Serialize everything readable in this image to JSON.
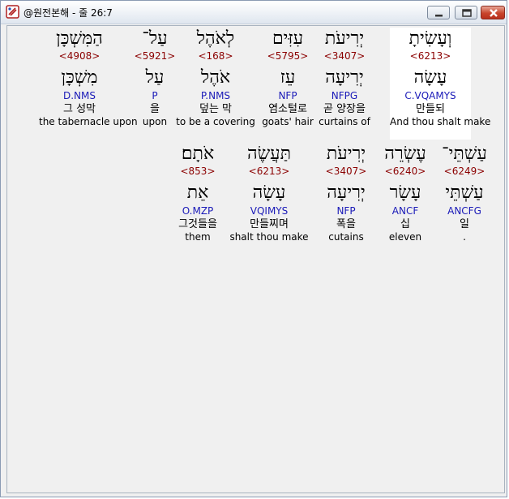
{
  "window": {
    "title": "@원전본해 - 줄 26:7"
  },
  "lines": [
    [
      {
        "heb": "וְעָשִׂיתָ",
        "strong": "<6213>",
        "lemma": "עָשָׂה",
        "morph": "C.VQAMYS",
        "ko": "만들되",
        "en": "And thou shalt make"
      },
      {
        "heb": "יְרִיעֹת",
        "strong": "<3407>",
        "lemma": "יְרִיעָה",
        "morph": "NFPG",
        "ko": "곧 양장을",
        "en": "curtains of"
      },
      {
        "heb": "עִזִּים",
        "strong": "<5795>",
        "lemma": "עֵז",
        "morph": "NFP",
        "ko": "염소털로",
        "en": "goats' hair"
      },
      {
        "heb": "לְאֹהֶל",
        "strong": "<168>",
        "lemma": "אֹהֶל",
        "morph": "P.NMS",
        "ko": "덮는 막",
        "en": "to be a covering"
      },
      {
        "heb": "עַל־",
        "strong": "<5921>",
        "lemma": "עַל",
        "morph": "P",
        "ko": "을",
        "en": "upon"
      },
      {
        "heb": "הַמִּשְׁכָּן",
        "strong": "<4908>",
        "lemma": "מִשְׁכָּן",
        "morph": "D.NMS",
        "ko": "그 성막",
        "en": "the tabernacle upon"
      }
    ],
    [
      {
        "heb": "עַשְׁתֵּי־",
        "strong": "<6249>",
        "lemma": "עַשְׁתֵּי",
        "morph": "ANCFG",
        "ko": "일",
        "en": "."
      },
      {
        "heb": "עֶשְׂרֵה",
        "strong": "<6240>",
        "lemma": "עָשָׂר",
        "morph": "ANCF",
        "ko": "십",
        "en": "eleven"
      },
      {
        "heb": "יְרִיעֹת",
        "strong": "<3407>",
        "lemma": "יְרִיעָה",
        "morph": "NFP",
        "ko": "폭을",
        "en": "cutains"
      },
      {
        "heb": "תַּעֲשֶׂה",
        "strong": "<6213>",
        "lemma": "עָשָׂה",
        "morph": "VQIMYS",
        "ko": "만들찌며",
        "en": "shalt thou make"
      },
      {
        "heb": "אֹתָם׃",
        "strong": "<853>",
        "lemma": "אֵת",
        "morph": "O.MZP",
        "ko": "그것들을",
        "en": "them"
      }
    ]
  ]
}
